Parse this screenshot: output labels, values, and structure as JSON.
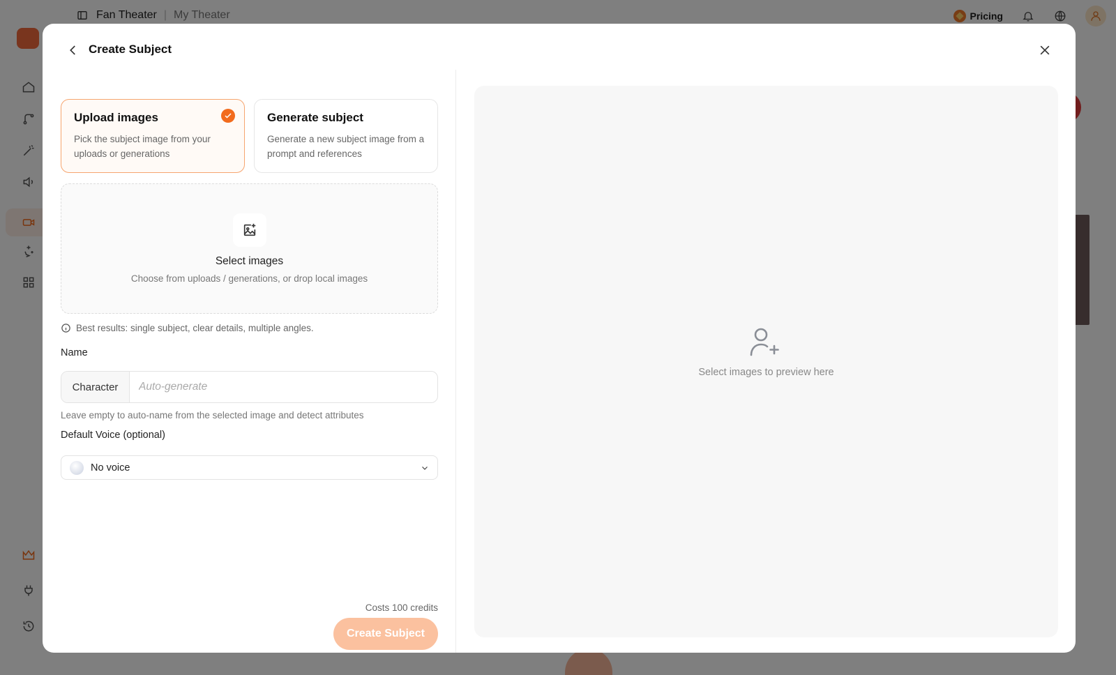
{
  "background_app": {
    "breadcrumb": [
      "Fan Theater",
      "My Theater"
    ],
    "pricing_label": "Pricing"
  },
  "modal": {
    "title": "Create Subject",
    "modes": [
      {
        "title": "Upload images",
        "description": "Pick the subject image from your uploads or generations",
        "selected": true
      },
      {
        "title": "Generate subject",
        "description": "Generate a new subject image from a prompt and references",
        "selected": false
      }
    ],
    "dropzone": {
      "title": "Select images",
      "subtitle": "Choose from uploads / generations, or drop local images"
    },
    "tip": "Best results: single subject, clear details, multiple angles.",
    "name_field": {
      "label": "Name",
      "prefix": "Character",
      "placeholder": "Auto-generate",
      "value": "",
      "helper": "Leave empty to auto-name from the selected image and detect attributes"
    },
    "voice_field": {
      "label": "Default Voice (optional)",
      "selected": "No voice"
    },
    "cost_text": "Costs 100 credits",
    "create_button": "Create Subject",
    "preview_placeholder": "Select images to preview here"
  },
  "colors": {
    "accent": "#f26b1d",
    "accent_disabled": "#fbc19f",
    "selected_border": "#f6a56f"
  }
}
